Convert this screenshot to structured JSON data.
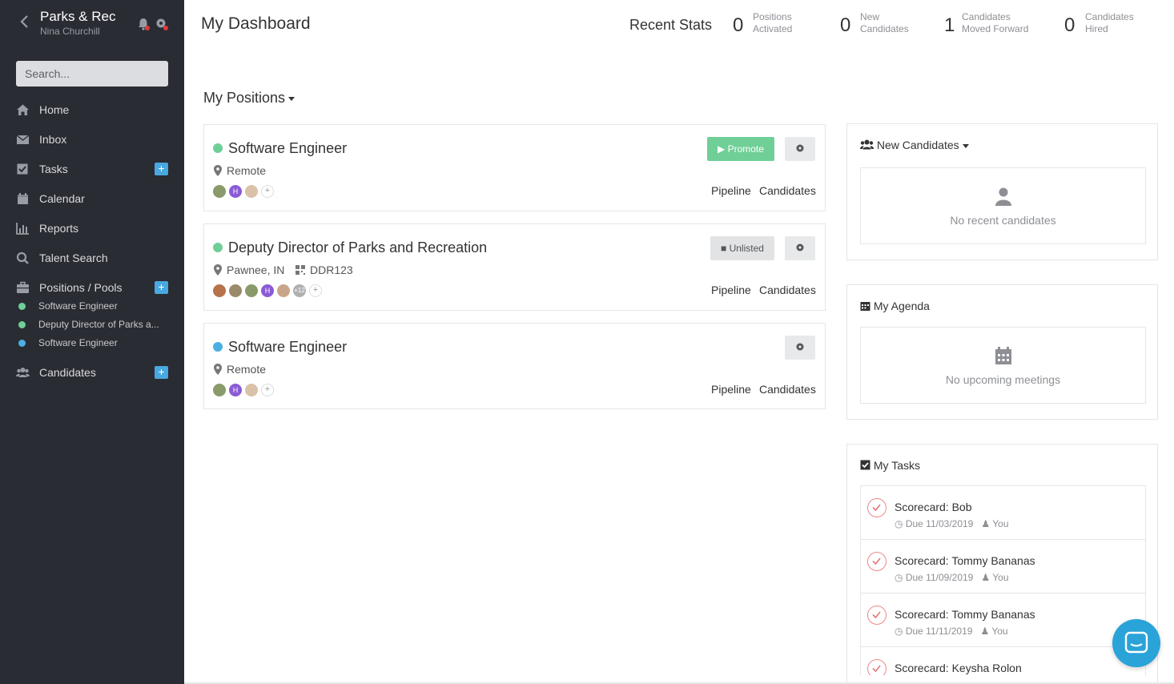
{
  "sidebar": {
    "org_name": "Parks & Rec",
    "user_name": "Nina Churchill",
    "search_placeholder": "Search...",
    "nav": {
      "home": "Home",
      "inbox": "Inbox",
      "tasks": "Tasks",
      "calendar": "Calendar",
      "reports": "Reports",
      "talent_search": "Talent Search",
      "positions": "Positions / Pools",
      "candidates": "Candidates"
    },
    "positions": [
      {
        "label": "Software Engineer",
        "color": "#6fcf97"
      },
      {
        "label": "Deputy Director of Parks a...",
        "color": "#6fcf97"
      },
      {
        "label": "Software Engineer",
        "color": "#4ab0e4"
      }
    ]
  },
  "header": {
    "title": "My Dashboard",
    "stats_title": "Recent Stats",
    "stats": [
      {
        "value": "0",
        "line1": "Positions",
        "line2": "Activated"
      },
      {
        "value": "0",
        "line1": "New",
        "line2": "Candidates"
      },
      {
        "value": "1",
        "line1": "Candidates",
        "line2": "Moved Forward"
      },
      {
        "value": "0",
        "line1": "Candidates",
        "line2": "Hired"
      }
    ]
  },
  "positions_title": "My Positions",
  "positions": [
    {
      "title": "Software Engineer",
      "location": "Remote",
      "status_color": "#6fcf97",
      "action": "Promote",
      "pipeline": "Pipeline",
      "candidates": "Candidates"
    },
    {
      "title": "Deputy Director of Parks and Recreation",
      "location": "Pawnee, IN",
      "code": "DDR123",
      "status_color": "#6fcf97",
      "action": "Unlisted",
      "more_count": "+12",
      "pipeline": "Pipeline",
      "candidates": "Candidates"
    },
    {
      "title": "Software Engineer",
      "location": "Remote",
      "status_color": "#4ab0e4",
      "pipeline": "Pipeline",
      "candidates": "Candidates"
    }
  ],
  "panels": {
    "new_candidates": {
      "title": "New Candidates",
      "empty": "No recent candidates"
    },
    "agenda": {
      "title": "My Agenda",
      "empty": "No upcoming meetings"
    },
    "tasks": {
      "title": "My Tasks",
      "items": [
        {
          "name": "Scorecard: Bob",
          "due": "Due 11/03/2019",
          "assignee": "You"
        },
        {
          "name": "Scorecard: Tommy Bananas",
          "due": "Due 11/09/2019",
          "assignee": "You"
        },
        {
          "name": "Scorecard: Tommy Bananas",
          "due": "Due 11/11/2019",
          "assignee": "You"
        },
        {
          "name": "Scorecard: Keysha Rolon",
          "due": "",
          "assignee": ""
        }
      ]
    }
  },
  "avatar_initial": "H",
  "colors": {
    "sidebar_bg": "#2a2c33",
    "accent_blue": "#4aa8e0",
    "promote_green": "#6fcf97",
    "avatar_purple": "#8b5bd6"
  }
}
